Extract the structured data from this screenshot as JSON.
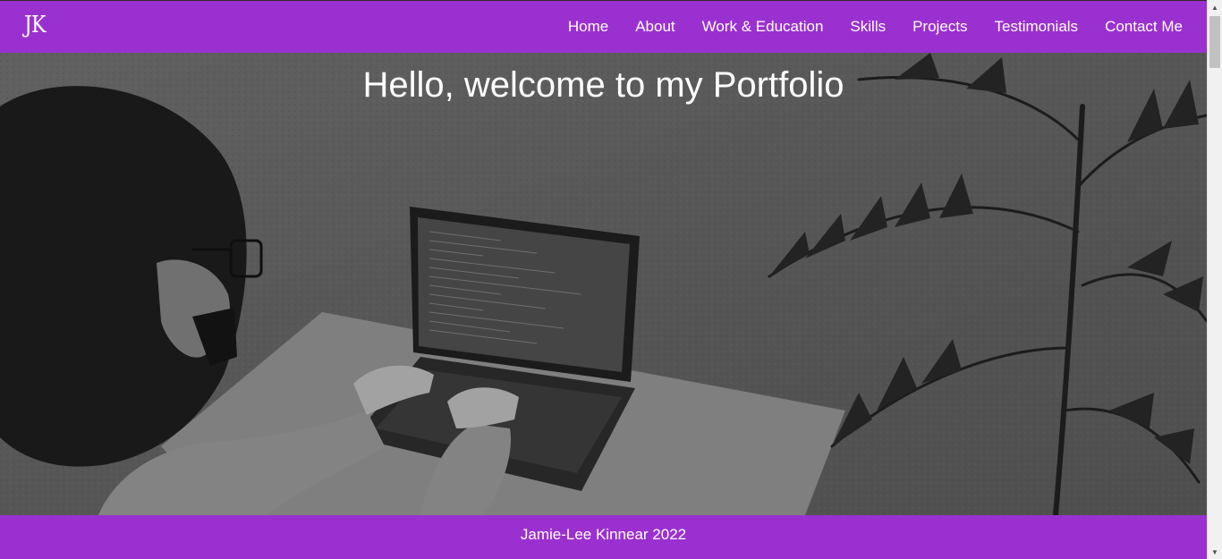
{
  "header": {
    "logo_text": "JK",
    "nav_items": [
      {
        "label": "Home"
      },
      {
        "label": "About"
      },
      {
        "label": "Work & Education"
      },
      {
        "label": "Skills"
      },
      {
        "label": "Projects"
      },
      {
        "label": "Testimonials"
      },
      {
        "label": "Contact Me"
      }
    ]
  },
  "hero": {
    "title": "Hello, welcome to my Portfolio",
    "image_alt": "person-coding-on-laptop-photo"
  },
  "footer": {
    "text": "Jamie-Lee Kinnear 2022"
  },
  "colors": {
    "brand_purple": "#9b30d0",
    "text_white": "#ffffff"
  }
}
